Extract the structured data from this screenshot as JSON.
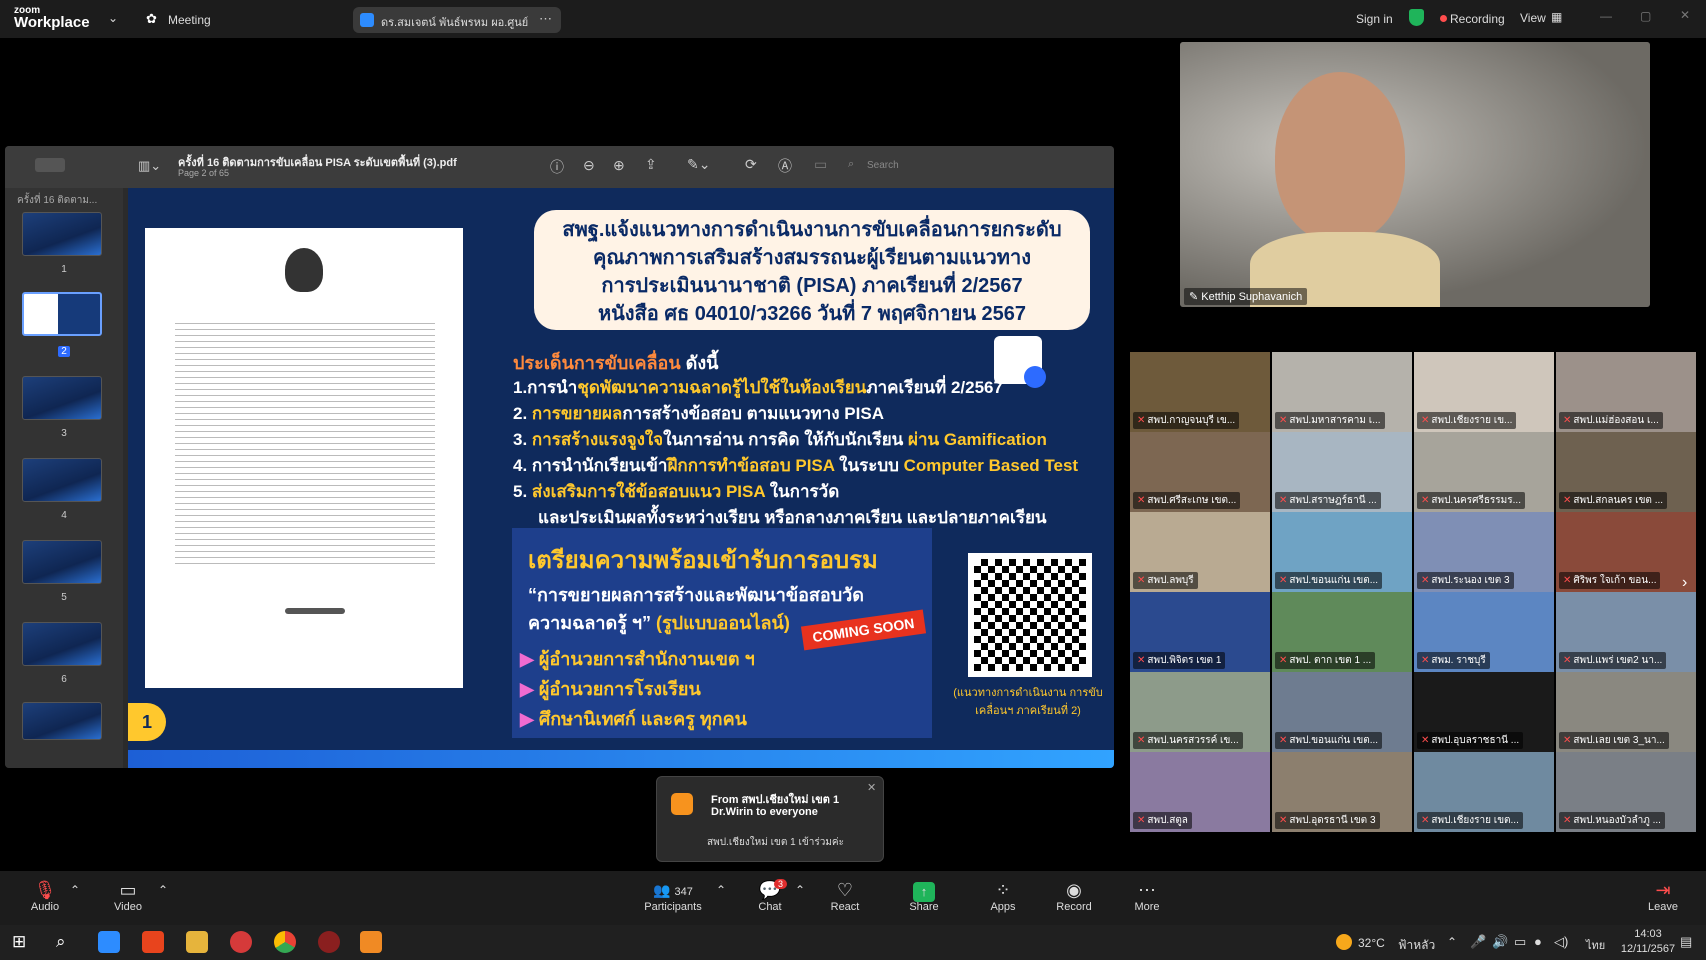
{
  "app": {
    "logo_small": "zoom",
    "logo_big": "Workplace",
    "meeting_label": "Meeting",
    "share_title": "ดร.สมเจตน์ พันธ์พรหม ผอ.ศูนย์ PISA ส",
    "sign_in": "Sign in",
    "recording": "Recording",
    "view": "View"
  },
  "pdf": {
    "filename": "ครั้งที่ 16 ติดตามการขับเคลื่อน PISA ระดับเขตพื้นที่ (3).pdf",
    "page_info": "Page 2 of 65",
    "search_placeholder": "Search",
    "sidebar_title": "ครั้งที่ 16 ติดตาม...",
    "thumbs": [
      "1",
      "2",
      "3",
      "4",
      "5",
      "6"
    ]
  },
  "slide": {
    "title_lines": [
      "สพฐ.แจ้งแนวทางการดำเนินงานการขับเคลื่อนการยกระดับ",
      "คุณภาพการเสริมสร้างสมรรถนะผู้เรียนตามแนวทาง",
      "การประเมินนานาชาติ (PISA) ภาคเรียนที่ 2/2567",
      "หนังสือ ศธ 04010/ว3266 วันที่ 7 พฤศจิกายน 2567"
    ],
    "issues_heading": "ประเด็นการขับเคลื่อน",
    "issues_suffix": "ดังนี้",
    "points": [
      {
        "a": "1.การนำ",
        "b": "ชุดพัฒนาความฉลาดรู้ไปใช้ในห้องเรียน",
        "c": "ภาคเรียนที่ 2/2567"
      },
      {
        "a": "2. ",
        "b": "การขยายผล",
        "c": "การสร้างข้อสอบ ตามแนวทาง PISA"
      },
      {
        "a": "3. ",
        "b": "การสร้างแรงจูงใจ",
        "c": "ในการอ่าน การคิด ให้กับนักเรียน ",
        "d": "ผ่าน Gamification"
      },
      {
        "a": "4. การนำนักเรียนเข้า",
        "b": "ฝึกการทำข้อสอบ PISA",
        "c": " ในระบบ ",
        "d": "Computer Based Test"
      },
      {
        "a": "5. ",
        "b": "ส่งเสริมการใช้ข้อสอบแนว PISA",
        "c": " ในการวัด"
      }
    ],
    "point5_cont": "และประเมินผลทั้งระหว่างเรียน หรือกลางภาคเรียน และปลายภาคเรียน",
    "panel_title": "เตรียมความพร้อมเข้ารับการอบรม",
    "panel_sub1": "“การขยายผลการสร้างและพัฒนาข้อสอบวัด",
    "panel_sub2a": "ความฉลาดรู้ ฯ”",
    "panel_sub2b": " (รูปแบบออนไลน์)",
    "coming_soon": "COMING SOON",
    "targets": [
      "ผู้อำนวยการสำนักงานเขต ฯ",
      "ผู้อำนวยการโรงเรียน",
      "ศึกษานิเทศก์ และครู ทุกคน"
    ],
    "qr_caption": "(แนวทางการดำเนินงาน การขับเคลื่อนฯ ภาคเรียนที่ 2)",
    "page_badge": "1"
  },
  "speaker": {
    "name": "Ketthip Suphavanich"
  },
  "tiles": [
    "สพป.กาญจนบุรี เข...",
    "สพป.มหาสารคาม เ...",
    "สพป.เชียงราย เข...",
    "สพป.แม่ฮ่องสอน เ...",
    "สพป.ศรีสะเกษ เขต...",
    "สพป.สราษฎร์ธานี ...",
    "สพป.นครศรีธรรมร...",
    "สพป.สกลนคร เขต ...",
    "สพป.ลพบุรี",
    "สพป.ขอนแก่น เขต...",
    "สพป.ระนอง เขต 3",
    "ศิริพร ใจเก้า ขอน...",
    "สพป.พิจิตร เขต 1",
    "สพป. ตาก เขต 1 ...",
    "สพม. ราชบุรี",
    "สพป.แพร่ เขต2 นา...",
    "สพป.นครสวรรค์ เข...",
    "สพป.ขอนแก่น เขต...",
    "สพป.อุบลราชธานี ...",
    "สพป.เลย เขต 3_นา...",
    "สพป.สตูล",
    "สพป.อุดรธานี เขต 3",
    "สพป.เชียงราย เขต...",
    "สพป.หนองบัวลำภู ..."
  ],
  "toast": {
    "from": "From สพป.เชียงใหม่ เขต 1",
    "from2": "Dr.Wirin to everyone",
    "message": "สพป.เชียงใหม่ เขต 1 เข้าร่วมค่ะ"
  },
  "bottom": {
    "audio": "Audio",
    "video": "Video",
    "participants": "Participants",
    "participants_count": "347",
    "chat": "Chat",
    "chat_badge": "3",
    "react": "React",
    "share": "Share",
    "apps": "Apps",
    "record": "Record",
    "more": "More",
    "leave": "Leave"
  },
  "taskbar": {
    "temp": "32°C",
    "weather": "ฟ้าหลัว",
    "lang": "ไทย",
    "time": "14:03",
    "date": "12/11/2567"
  },
  "colors": {
    "slide_bg": "#0f2a5c",
    "highlight": "#ffc82d",
    "record_red": "#ff4d4d",
    "share_green": "#1fb45a"
  }
}
